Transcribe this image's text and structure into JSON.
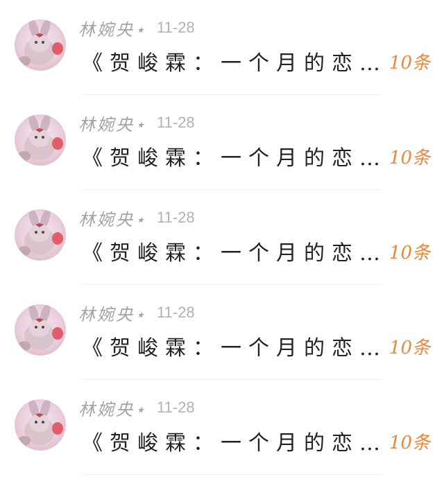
{
  "conversations": [
    {
      "username": "林婉央⋆",
      "date": "11-28",
      "message": "《贺峻霖：一个月的恋…",
      "count": "10条"
    },
    {
      "username": "林婉央⋆",
      "date": "11-28",
      "message": "《贺峻霖：一个月的恋…",
      "count": "10条"
    },
    {
      "username": "林婉央⋆",
      "date": "11-28",
      "message": "《贺峻霖：一个月的恋…",
      "count": "10条"
    },
    {
      "username": "林婉央⋆",
      "date": "11-28",
      "message": "《贺峻霖：一个月的恋…",
      "count": "10条"
    },
    {
      "username": "林婉央⋆",
      "date": "11-28",
      "message": "《贺峻霖：一个月的恋…",
      "count": "10条"
    }
  ],
  "colors": {
    "username": "#a4a4a4",
    "date": "#b2b2b2",
    "message": "#222222",
    "count_accent": "#e8883d"
  },
  "icons": {
    "avatar": "plush-bunny-avatar-icon"
  }
}
